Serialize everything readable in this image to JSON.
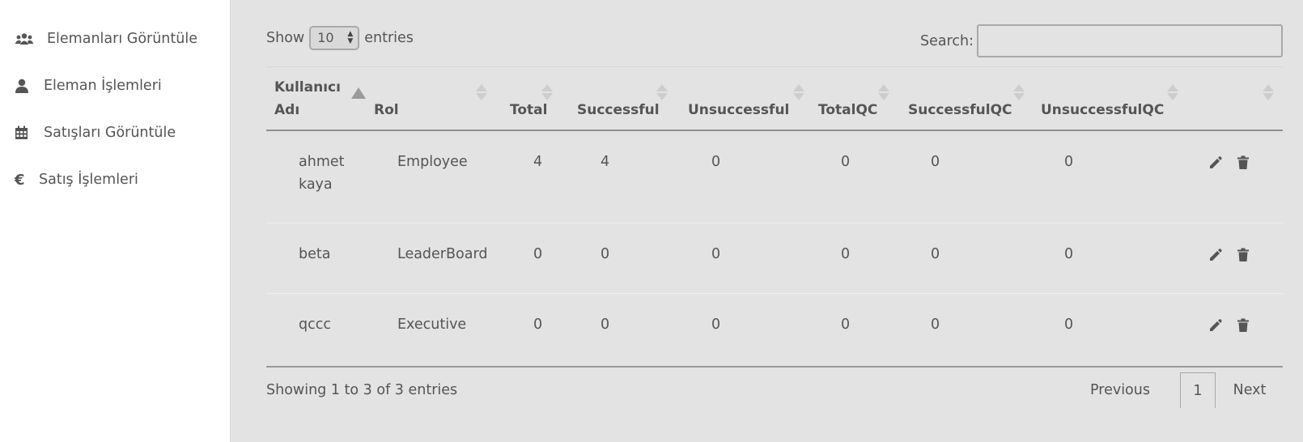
{
  "sidebar": {
    "items": [
      {
        "label": "Elemanları Görüntüle",
        "icon": "users-icon"
      },
      {
        "label": "Eleman İşlemleri",
        "icon": "user-icon"
      },
      {
        "label": "Satışları Görüntüle",
        "icon": "calendar-icon"
      },
      {
        "label": "Satış İşlemleri",
        "icon": "euro-icon"
      }
    ]
  },
  "controls": {
    "show_label": "Show",
    "length_value": "10",
    "entries_label": "entries",
    "search_label": "Search:",
    "search_value": ""
  },
  "table": {
    "columns": [
      "Kullanıcı Adı",
      "Rol",
      "Total",
      "Successful",
      "Unsuccessful",
      "TotalQC",
      "SuccessfulQC",
      "UnsuccessfulQC",
      ""
    ],
    "sorted_column": "Kullanıcı Adı",
    "sort_direction": "ascending",
    "rows": [
      {
        "username": "ahmet kaya",
        "role": "Employee",
        "total": "4",
        "successful": "4",
        "unsuccessful": "0",
        "totalqc": "0",
        "successfulqc": "0",
        "unsuccessfulqc": "0"
      },
      {
        "username": "beta",
        "role": "LeaderBoard",
        "total": "0",
        "successful": "0",
        "unsuccessful": "0",
        "totalqc": "0",
        "successfulqc": "0",
        "unsuccessfulqc": "0"
      },
      {
        "username": "qccc",
        "role": "Executive",
        "total": "0",
        "successful": "0",
        "unsuccessful": "0",
        "totalqc": "0",
        "successfulqc": "0",
        "unsuccessfulqc": "0"
      }
    ]
  },
  "footer": {
    "info": "Showing 1 to 3 of 3 entries",
    "previous": "Previous",
    "current_page": "1",
    "next": "Next"
  }
}
